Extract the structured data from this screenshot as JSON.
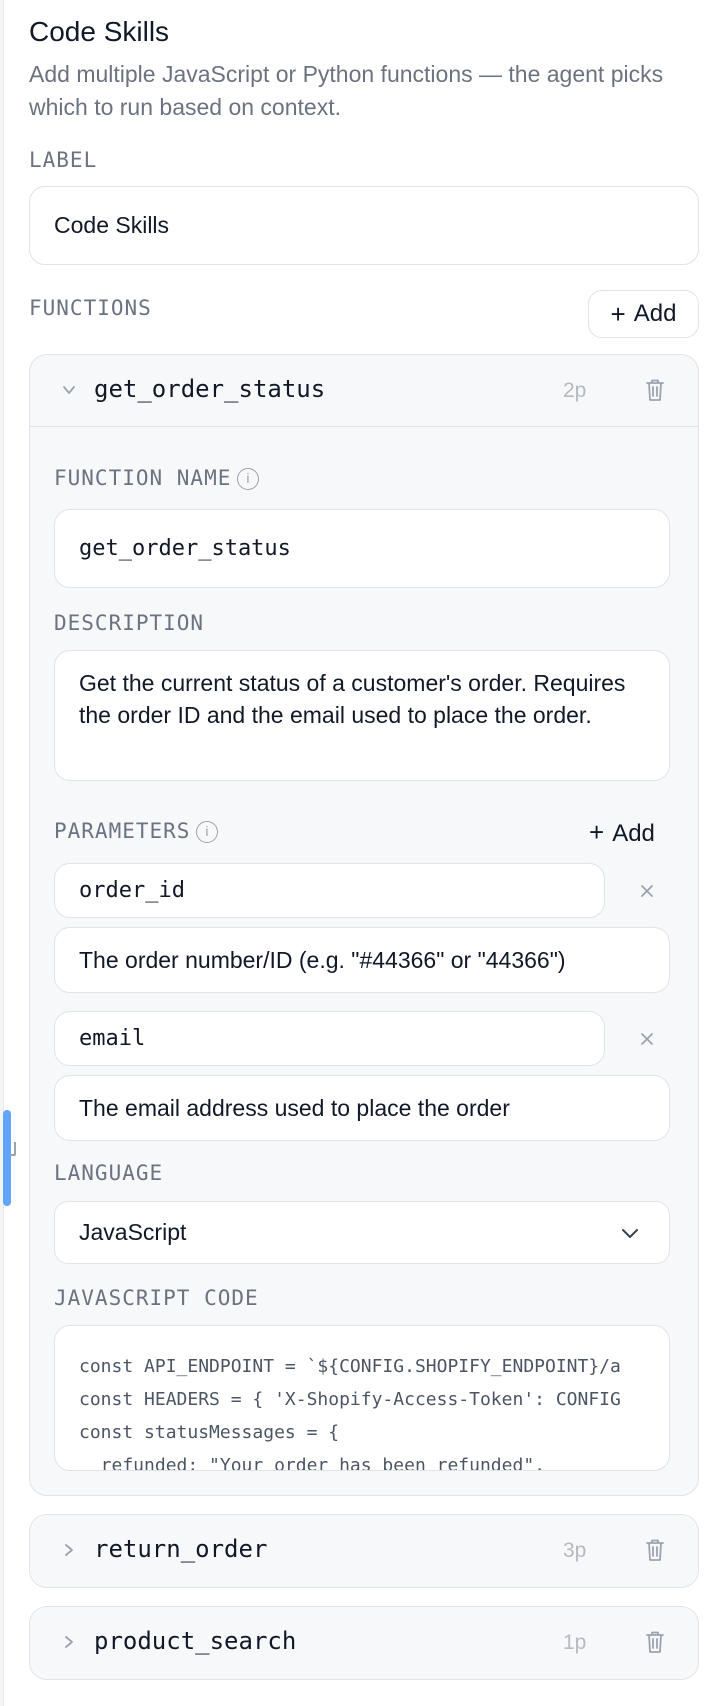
{
  "header": {
    "title": "Code Skills",
    "subtitle": "Add multiple JavaScript or Python functions — the agent picks which to run based on context."
  },
  "label_field": {
    "label": "LABEL",
    "value": "Code Skills"
  },
  "functions_section": {
    "label": "FUNCTIONS",
    "add_label": "Add"
  },
  "functions": [
    {
      "name": "get_order_status",
      "param_count": "2p",
      "expanded": true,
      "function_name_label": "FUNCTION NAME",
      "function_name_value": "get_order_status",
      "description_label": "DESCRIPTION",
      "description": "Get the current status of a customer's order. Requires the order ID and the email used to place the order.",
      "parameters_label": "PARAMETERS",
      "parameters_add_label": "Add",
      "parameters": [
        {
          "name": "order_id",
          "description": "The order number/ID (e.g. \"#44366\" or \"44366\")"
        },
        {
          "name": "email",
          "description": "The email address used to place the order"
        }
      ],
      "language_label": "LANGUAGE",
      "language": "JavaScript",
      "code_label": "JAVASCRIPT CODE",
      "code_lines": [
        "const API_ENDPOINT = `${CONFIG.SHOPIFY_ENDPOINT}/a",
        "const HEADERS = { 'X-Shopify-Access-Token': CONFIG",
        "const statusMessages = {",
        "  refunded: \"Your order has been refunded\","
      ]
    },
    {
      "name": "return_order",
      "param_count": "3p",
      "expanded": false
    },
    {
      "name": "product_search",
      "param_count": "1p",
      "expanded": false
    }
  ],
  "icons": {
    "chevron_down": "chevron-down-icon",
    "chevron_right": "chevron-right-icon",
    "trash": "trash-icon",
    "info": "info-icon",
    "close": "close-icon",
    "plus": "plus-icon"
  },
  "colors": {
    "accent": "#60a5fa",
    "border": "#e0e3e8",
    "muted_text": "#6b7280"
  }
}
